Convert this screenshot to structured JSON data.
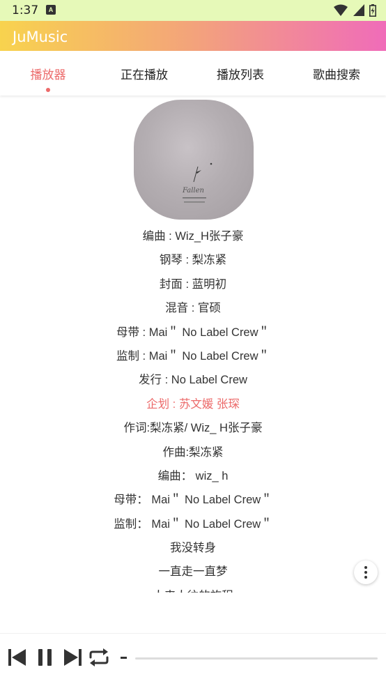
{
  "status_bar": {
    "time": "1:37",
    "notification_icon": "A"
  },
  "app": {
    "title": "JuMusic"
  },
  "tabs": [
    {
      "label": "播放器",
      "active": true
    },
    {
      "label": "正在播放",
      "active": false
    },
    {
      "label": "播放列表",
      "active": false
    },
    {
      "label": "歌曲搜索",
      "active": false
    }
  ],
  "cover": {
    "art_text": "Fallen"
  },
  "credits": [
    {
      "text": "编曲 : Wiz_H张子豪"
    },
    {
      "text": "钢琴 : 梨冻紧"
    },
    {
      "text": "封面 : 蓝明初"
    },
    {
      "text": "混音 : 官硕"
    },
    {
      "text": "母带 : Mai＂ No Label Crew＂"
    },
    {
      "text": "监制 : Mai＂ No Label Crew＂"
    },
    {
      "text": "发行 : No Label Crew"
    },
    {
      "text": "企划 : 苏文媛 张琛",
      "highlight": true
    },
    {
      "text": "作词:梨冻紧/ Wiz_ H张子豪"
    },
    {
      "text": "作曲:梨冻紧"
    },
    {
      "text": "编曲： wiz_ h"
    },
    {
      "text": "母带： Mai＂ No Label Crew＂"
    },
    {
      "text": "监制： Mai＂ No Label Crew＂"
    },
    {
      "text": "我没转身"
    },
    {
      "text": "一直走一直梦"
    },
    {
      "text": "人来人往的旅程"
    }
  ],
  "player": {
    "time_display": "-",
    "progress": 0
  },
  "colors": {
    "accent": "#ec6a6a",
    "status_bar": "#e6f9b8",
    "app_bar_gradient": [
      "#f8d34e",
      "#f3a37b",
      "#f06cb9"
    ]
  },
  "icons": {
    "previous": "skip-previous-icon",
    "pause": "pause-icon",
    "next": "skip-next-icon",
    "repeat": "repeat-icon",
    "more": "more-vertical-icon"
  }
}
